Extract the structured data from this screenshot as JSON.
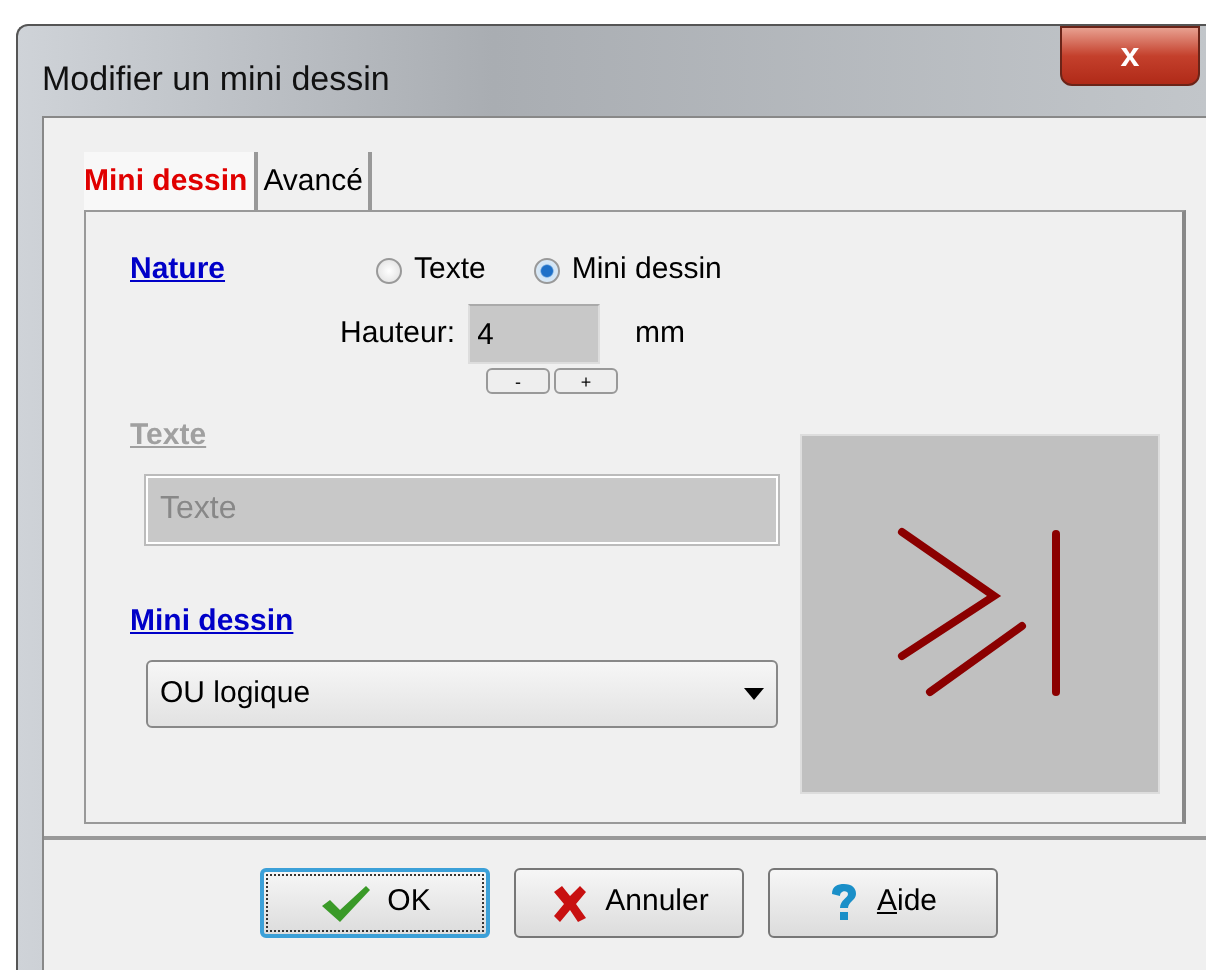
{
  "window": {
    "title": "Modifier un mini dessin",
    "close": "x"
  },
  "tabs": [
    {
      "label": "Mini dessin",
      "selected": true
    },
    {
      "label": "Avancé",
      "selected": false
    }
  ],
  "nature": {
    "label": "Nature",
    "options": [
      {
        "label": "Texte",
        "selected": false
      },
      {
        "label": "Mini dessin",
        "selected": true
      }
    ]
  },
  "hauteur": {
    "label": "Hauteur:",
    "value": "4",
    "unit": "mm",
    "minus": "-",
    "plus": "+"
  },
  "texte": {
    "label": "Texte",
    "value": "Texte",
    "disabled": true
  },
  "mini_dessin": {
    "label": "Mini dessin",
    "value": "OU logique",
    "disabled": false
  },
  "buttons": [
    {
      "kind": "ok",
      "label": "OK",
      "focused": true
    },
    {
      "kind": "cancel",
      "label": "Annuler",
      "focused": false
    },
    {
      "kind": "help",
      "label": "Aide",
      "focused": false
    }
  ]
}
